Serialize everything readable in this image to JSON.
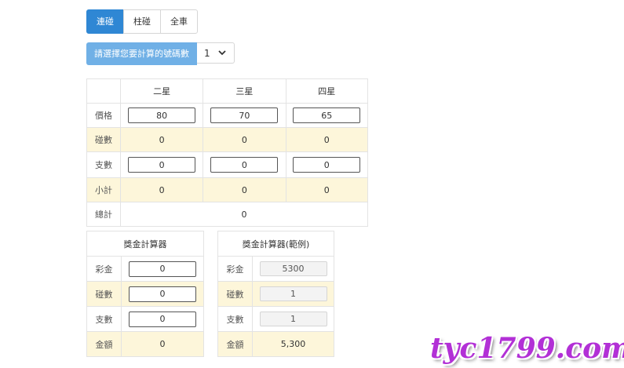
{
  "tabs": [
    "連碰",
    "柱碰",
    "全車"
  ],
  "select": {
    "label": "請選擇您要計算的號碼數",
    "value": "1"
  },
  "main_table": {
    "headers": [
      "二星",
      "三星",
      "四星"
    ],
    "price": {
      "label": "價格",
      "values": [
        "80",
        "70",
        "65"
      ]
    },
    "combos": {
      "label": "碰數",
      "values": [
        "0",
        "0",
        "0"
      ]
    },
    "units": {
      "label": "支數",
      "values": [
        "0",
        "0",
        "0"
      ]
    },
    "subtotal": {
      "label": "小計",
      "values": [
        "0",
        "0",
        "0"
      ]
    },
    "total": {
      "label": "總計",
      "value": "0"
    }
  },
  "prize_calc": {
    "title": "獎金計算器",
    "prize": {
      "label": "彩金",
      "value": "0"
    },
    "combos": {
      "label": "碰數",
      "value": "0"
    },
    "units": {
      "label": "支數",
      "value": "0"
    },
    "amount": {
      "label": "金額",
      "value": "0"
    }
  },
  "prize_example": {
    "title": "獎金計算器(範例)",
    "prize": {
      "label": "彩金",
      "value": "5300"
    },
    "combos": {
      "label": "碰數",
      "value": "1"
    },
    "units": {
      "label": "支數",
      "value": "1"
    },
    "amount": {
      "label": "金額",
      "value": "5,300"
    }
  },
  "watermark": "tyc1799.com",
  "colors": {
    "accent": "#2f87d4",
    "label_bg": "#70b0e6",
    "highlight_row": "#fdf6da",
    "watermark": "#b230d6"
  }
}
